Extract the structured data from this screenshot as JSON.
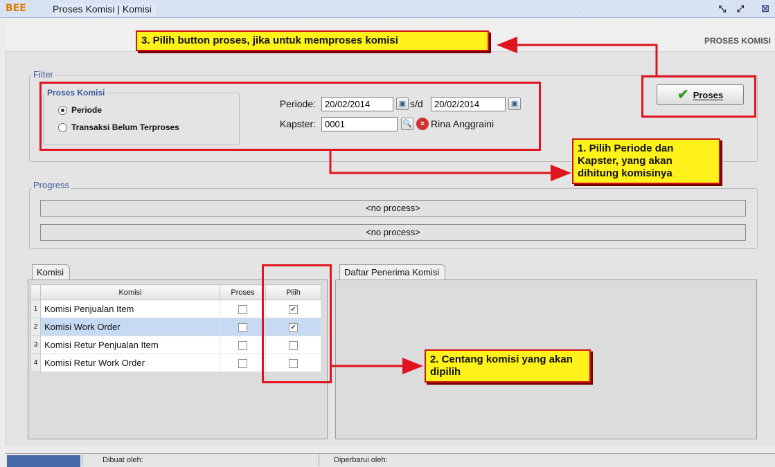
{
  "window": {
    "logo": "BEE",
    "title": "Proses Komisi | Komisi",
    "controls": {
      "restore": "restore-icon",
      "maximize": "maximize-icon",
      "close": "close-icon"
    }
  },
  "page_header": "PROSES KOMISI",
  "filter": {
    "legend": "Filter",
    "proses_komisi": {
      "legend": "Proses Komisi",
      "options": [
        {
          "label": "Periode",
          "checked": true
        },
        {
          "label": "Transaksi Belum Terproses",
          "checked": false
        }
      ]
    },
    "periode_label": "Periode:",
    "periode_from": "20/02/2014",
    "sd_label": "s/d",
    "periode_to": "20/02/2014",
    "kapster_label": "Kapster:",
    "kapster_code": "0001",
    "kapster_name": "Rina Anggraini"
  },
  "proses_button": {
    "label": "Proses",
    "icon": "check-icon"
  },
  "progress": {
    "legend": "Progress",
    "bars": [
      "<no process>",
      "<no process>"
    ]
  },
  "tabs": {
    "komisi": "Komisi",
    "daftar": "Daftar Penerima Komisi"
  },
  "komisi_table": {
    "columns": [
      "Komisi",
      "Proses",
      "Pilih"
    ],
    "rows": [
      {
        "no": "1",
        "name": "Komisi Penjualan Item",
        "proses": false,
        "pilih": true,
        "selected": false
      },
      {
        "no": "2",
        "name": "Komisi Work Order",
        "proses": false,
        "pilih": true,
        "selected": true
      },
      {
        "no": "3",
        "name": "Komisi Retur Penjualan Item",
        "proses": false,
        "pilih": false,
        "selected": false
      },
      {
        "no": "4",
        "name": "Komisi Retur Work Order",
        "proses": false,
        "pilih": false,
        "selected": false
      }
    ]
  },
  "status_bar": {
    "dibuat": "Dibuat oleh:",
    "diperbarui": "Diperbarui oleh:"
  },
  "annotations": {
    "step3": "3. Pilih button proses, jika untuk memproses komisi",
    "step1": "1. Pilih Periode dan Kapster, yang akan dihitung komisinya",
    "step2": "2. Centang komisi yang akan dipilih",
    "highlight_color": "#e0141e",
    "callout_color": "#fff21a"
  }
}
